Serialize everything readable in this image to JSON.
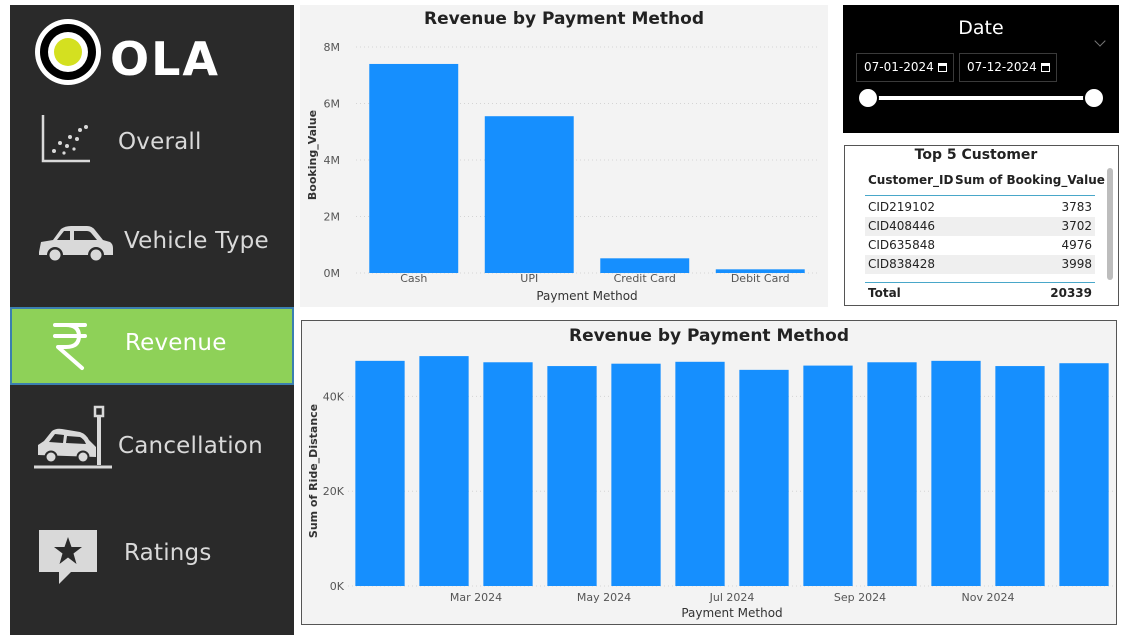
{
  "brand": {
    "name": "OLA"
  },
  "nav": [
    {
      "id": "overall",
      "label": "Overall",
      "icon": "scatter-chart-icon",
      "active": false
    },
    {
      "id": "vehicle",
      "label": "Vehicle Type",
      "icon": "car-icon",
      "active": false
    },
    {
      "id": "revenue",
      "label": "Revenue",
      "icon": "rupee-icon",
      "active": true
    },
    {
      "id": "cancellation",
      "label": "Cancellation",
      "icon": "car-crash-icon",
      "active": false
    },
    {
      "id": "ratings",
      "label": "Ratings",
      "icon": "star-speech-icon",
      "active": false
    }
  ],
  "colors": {
    "bar": "#168ffe",
    "sidebar": "#2a2a2a",
    "active_nav": "#8ed158"
  },
  "date_slicer": {
    "title": "Date",
    "start": "07-01-2024",
    "end": "07-12-2024",
    "range_selected": [
      0,
      1
    ]
  },
  "top_customers": {
    "title": "Top 5 Customer",
    "headers": [
      "Customer_ID",
      "Sum of Booking_Value"
    ],
    "rows": [
      {
        "id": "CID219102",
        "value": "3783"
      },
      {
        "id": "CID408446",
        "value": "3702"
      },
      {
        "id": "CID635848",
        "value": "4976"
      },
      {
        "id": "CID838428",
        "value": "3998"
      }
    ],
    "total_label": "Total",
    "total_value": "20339"
  },
  "chart_data": [
    {
      "type": "bar",
      "title": "Revenue by Payment Method",
      "xlabel": "Payment Method",
      "ylabel": "Booking_Value",
      "categories": [
        "Cash",
        "UPI",
        "Credit Card",
        "Debit Card"
      ],
      "values": [
        7400000,
        5550000,
        520000,
        130000
      ],
      "ylim": [
        0,
        8000000
      ],
      "yticks": [
        0,
        2000000,
        4000000,
        6000000,
        8000000
      ],
      "ytick_labels": [
        "0M",
        "2M",
        "4M",
        "6M",
        "8M"
      ],
      "grid": true
    },
    {
      "type": "bar",
      "title": "Revenue by Payment Method",
      "xlabel": "Payment Method",
      "ylabel": "Sum of Ride_Distance",
      "categories": [
        "2024-01",
        "2024-02",
        "2024-03",
        "2024-04",
        "2024-05",
        "2024-06",
        "2024-07",
        "2024-08",
        "2024-09",
        "2024-10",
        "2024-11",
        "2024-12"
      ],
      "values": [
        47500,
        48500,
        47200,
        46400,
        46900,
        47300,
        45600,
        46500,
        47200,
        47500,
        46400,
        47000
      ],
      "ylim": [
        0,
        50000
      ],
      "yticks": [
        0,
        20000,
        40000
      ],
      "ytick_labels": [
        "0K",
        "20K",
        "40K"
      ],
      "xtick_labels": [
        {
          "index": 2,
          "label": "Mar 2024"
        },
        {
          "index": 4,
          "label": "May 2024"
        },
        {
          "index": 6,
          "label": "Jul 2024"
        },
        {
          "index": 8,
          "label": "Sep 2024"
        },
        {
          "index": 10,
          "label": "Nov 2024"
        }
      ],
      "grid": true
    }
  ]
}
